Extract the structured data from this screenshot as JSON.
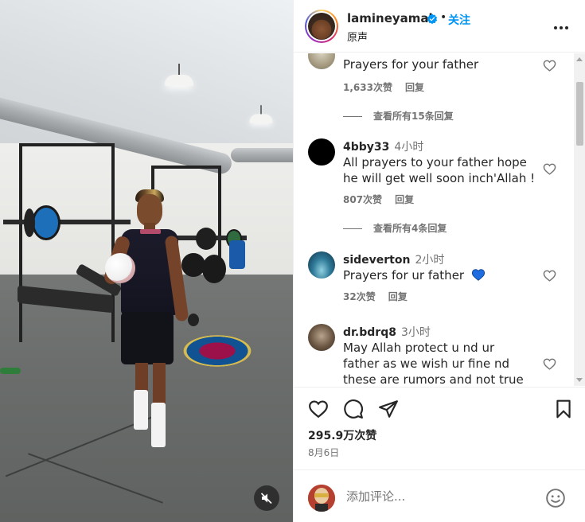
{
  "post": {
    "username": "lamineyamal",
    "follow_label": "关注",
    "dot": "•",
    "audio_label": "原声",
    "likes": "295.9万次赞",
    "date": "8月6日"
  },
  "comments": [
    {
      "user": "",
      "time": "",
      "text": "Prayers for your father",
      "likes": "1,633次赞",
      "reply": "回复",
      "view_replies": "查看所有15条回复"
    },
    {
      "user": "4bby33",
      "time": "4小时",
      "text": "All prayers to your father hope he will get well soon inch'Allah !",
      "likes": "807次赞",
      "reply": "回复",
      "view_replies": "查看所有4条回复"
    },
    {
      "user": "sideverton",
      "time": "2小时",
      "text": "Prayers for ur father",
      "likes": "32次赞",
      "reply": "回复"
    },
    {
      "user": "dr.bdrq8",
      "time": "3小时",
      "text": "May Allah protect u nd ur father as we wish ur fine nd these are rumors and not true news.."
    }
  ],
  "compose": {
    "placeholder": "添加评论..."
  },
  "icons": {
    "verified": "verified-badge-icon",
    "more": "more-options-icon",
    "like": "heart-icon",
    "comment": "comment-bubble-icon",
    "share": "paper-plane-icon",
    "save": "bookmark-icon",
    "emoji": "smiley-icon",
    "mute": "speaker-muted-icon"
  },
  "colors": {
    "accent": "#0095f6",
    "verified": "#0095f6",
    "blue_heart": "#1d6de0",
    "muted_text": "#737373"
  }
}
